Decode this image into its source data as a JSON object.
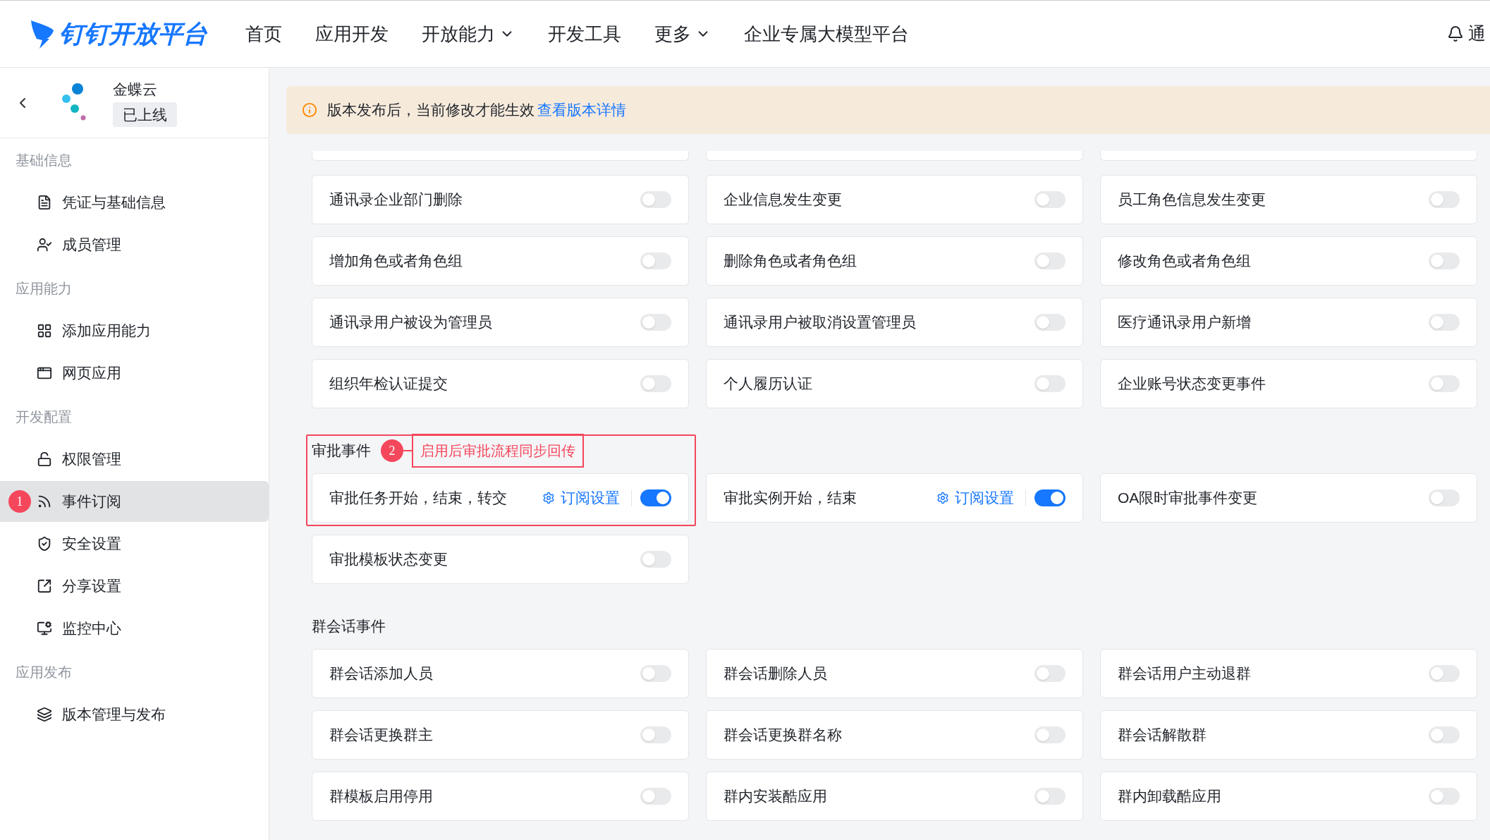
{
  "header": {
    "logo": "钉钉开放平台",
    "nav": [
      {
        "label": "首页",
        "dropdown": false
      },
      {
        "label": "应用开发",
        "dropdown": false
      },
      {
        "label": "开放能力",
        "dropdown": true
      },
      {
        "label": "开发工具",
        "dropdown": false
      },
      {
        "label": "更多",
        "dropdown": true
      },
      {
        "label": "企业专属大模型平台",
        "dropdown": false
      }
    ],
    "notification": "通"
  },
  "sidebar": {
    "app": {
      "name": "金蝶云",
      "status": "已上线"
    },
    "groups": [
      {
        "title": "基础信息",
        "items": [
          {
            "label": "凭证与基础信息",
            "selected": false
          },
          {
            "label": "成员管理",
            "selected": false
          }
        ]
      },
      {
        "title": "应用能力",
        "items": [
          {
            "label": "添加应用能力",
            "selected": false
          },
          {
            "label": "网页应用",
            "selected": false
          }
        ]
      },
      {
        "title": "开发配置",
        "items": [
          {
            "label": "权限管理",
            "selected": false
          },
          {
            "label": "事件订阅",
            "selected": true,
            "marker": "1"
          },
          {
            "label": "安全设置",
            "selected": false
          },
          {
            "label": "分享设置",
            "selected": false
          },
          {
            "label": "监控中心",
            "selected": false
          }
        ]
      },
      {
        "title": "应用发布",
        "items": [
          {
            "label": "版本管理与发布",
            "selected": false
          }
        ]
      }
    ]
  },
  "banner": {
    "text": "版本发布后，当前修改才能生效",
    "link": "查看版本详情"
  },
  "sections": [
    {
      "events": [
        {
          "label": "通讯录企业部门删除",
          "on": false
        },
        {
          "label": "企业信息发生变更",
          "on": false
        },
        {
          "label": "员工角色信息发生变更",
          "on": false
        },
        {
          "label": "增加角色或者角色组",
          "on": false
        },
        {
          "label": "删除角色或者角色组",
          "on": false
        },
        {
          "label": "修改角色或者角色组",
          "on": false
        },
        {
          "label": "通讯录用户被设为管理员",
          "on": false
        },
        {
          "label": "通讯录用户被取消设置管理员",
          "on": false
        },
        {
          "label": "医疗通讯录用户新增",
          "on": false
        },
        {
          "label": "组织年检认证提交",
          "on": false
        },
        {
          "label": "个人履历认证",
          "on": false
        },
        {
          "label": "企业账号状态变更事件",
          "on": false
        }
      ]
    },
    {
      "title": "审批事件",
      "marker": "2",
      "callout": "启用后审批流程同步回传",
      "events": [
        {
          "label": "审批任务开始，结束，转交",
          "on": true,
          "settings": "订阅设置"
        },
        {
          "label": "审批实例开始，结束",
          "on": true,
          "settings": "订阅设置"
        },
        {
          "label": "OA限时审批事件变更",
          "on": false
        },
        {
          "label": "审批模板状态变更",
          "on": false
        }
      ]
    },
    {
      "title": "群会话事件",
      "events": [
        {
          "label": "群会话添加人员",
          "on": false
        },
        {
          "label": "群会话删除人员",
          "on": false
        },
        {
          "label": "群会话用户主动退群",
          "on": false
        },
        {
          "label": "群会话更换群主",
          "on": false
        },
        {
          "label": "群会话更换群名称",
          "on": false
        },
        {
          "label": "群会话解散群",
          "on": false
        },
        {
          "label": "群模板启用停用",
          "on": false
        },
        {
          "label": "群内安装酷应用",
          "on": false
        },
        {
          "label": "群内卸载酷应用",
          "on": false
        }
      ]
    }
  ]
}
